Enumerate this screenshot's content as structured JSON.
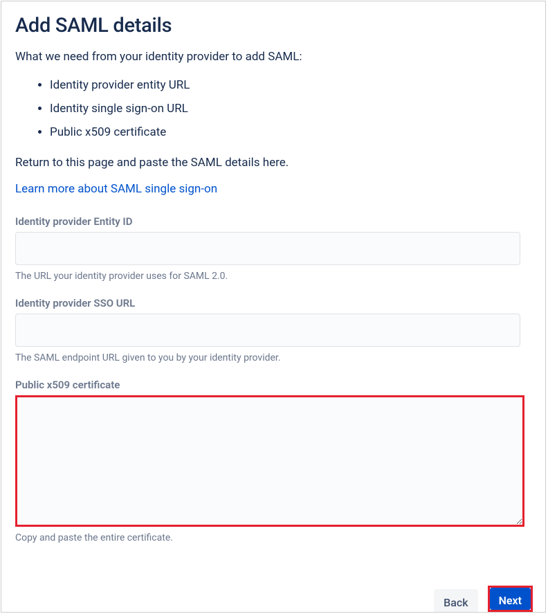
{
  "page": {
    "title": "Add SAML details",
    "intro": "What we need from your identity provider to add SAML:",
    "requirements": [
      "Identity provider entity URL",
      "Identity single sign-on URL",
      "Public x509 certificate"
    ],
    "returnText": "Return to this page and paste the SAML details here.",
    "learnMore": "Learn more about SAML single sign-on"
  },
  "fields": {
    "entityId": {
      "label": "Identity provider Entity ID",
      "value": "",
      "help": "The URL your identity provider uses for SAML 2.0."
    },
    "ssoUrl": {
      "label": "Identity provider SSO URL",
      "value": "",
      "help": "The SAML endpoint URL given to you by your identity provider."
    },
    "x509": {
      "label": "Public x509 certificate",
      "value": "",
      "help": "Copy and paste the entire certificate."
    }
  },
  "buttons": {
    "back": "Back",
    "next": "Next"
  }
}
